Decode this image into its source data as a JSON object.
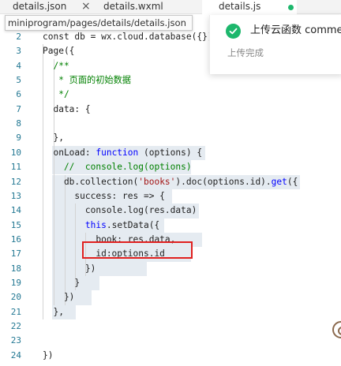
{
  "tabs": [
    {
      "label": "details.json",
      "close_icon": "×"
    },
    {
      "label": "details.wxml"
    },
    {
      "label": "details.js",
      "modified_dot_color": "#1db76c"
    }
  ],
  "breadcrumb": "miniprogram/pages/details/details.json",
  "toast": {
    "title": "上传云函数 comme",
    "subtitle": "上传完成",
    "icon": "check-circle-icon",
    "icon_color": "#1db76c"
  },
  "highlight_color": "#e0201f",
  "editor": {
    "lines": [
      {
        "no": "2",
        "tokens": [
          [
            "plain",
            "const db = wx.cloud.database({})"
          ]
        ]
      },
      {
        "no": "3",
        "tokens": [
          [
            "plain",
            "Page({"
          ]
        ]
      },
      {
        "no": "4",
        "tokens": [
          [
            "comment",
            "  /**"
          ]
        ]
      },
      {
        "no": "5",
        "tokens": [
          [
            "comment",
            "   * 页面的初始数据"
          ]
        ]
      },
      {
        "no": "6",
        "tokens": [
          [
            "comment",
            "   */"
          ]
        ]
      },
      {
        "no": "7",
        "tokens": [
          [
            "plain",
            "  data: {"
          ]
        ]
      },
      {
        "no": "8",
        "tokens": [
          [
            "plain",
            ""
          ]
        ]
      },
      {
        "no": "9",
        "tokens": [
          [
            "plain",
            "  },"
          ]
        ]
      },
      {
        "no": "10",
        "tokens": [
          [
            "plain",
            "  onLoad: "
          ],
          [
            "key",
            "function"
          ],
          [
            "plain",
            " (options) {"
          ]
        ]
      },
      {
        "no": "11",
        "tokens": [
          [
            "comment",
            "    //  console.log(options)"
          ]
        ]
      },
      {
        "no": "12",
        "tokens": [
          [
            "plain",
            "    db.collection("
          ],
          [
            "str",
            "'books'"
          ],
          [
            "plain",
            ").doc(options.id)."
          ],
          [
            "key",
            "get"
          ],
          [
            "plain",
            "({"
          ]
        ]
      },
      {
        "no": "13",
        "tokens": [
          [
            "plain",
            "      success: res => {"
          ]
        ]
      },
      {
        "no": "14",
        "tokens": [
          [
            "plain",
            "        console.log(res.data)"
          ]
        ]
      },
      {
        "no": "15",
        "tokens": [
          [
            "plain",
            "        "
          ],
          [
            "key",
            "this"
          ],
          [
            "plain",
            ".setData({"
          ]
        ]
      },
      {
        "no": "16",
        "tokens": [
          [
            "plain",
            "          book: res.data,"
          ]
        ]
      },
      {
        "no": "17",
        "tokens": [
          [
            "plain",
            "          id:options.id"
          ]
        ]
      },
      {
        "no": "18",
        "tokens": [
          [
            "plain",
            "        })"
          ]
        ]
      },
      {
        "no": "19",
        "tokens": [
          [
            "plain",
            "      }"
          ]
        ]
      },
      {
        "no": "20",
        "tokens": [
          [
            "plain",
            "    })"
          ]
        ]
      },
      {
        "no": "21",
        "tokens": [
          [
            "plain",
            "  },"
          ]
        ]
      },
      {
        "no": "22",
        "tokens": [
          [
            "plain",
            ""
          ]
        ]
      },
      {
        "no": "23",
        "tokens": [
          [
            "plain",
            ""
          ]
        ]
      },
      {
        "no": "24",
        "tokens": [
          [
            "plain",
            "})"
          ]
        ]
      }
    ]
  }
}
